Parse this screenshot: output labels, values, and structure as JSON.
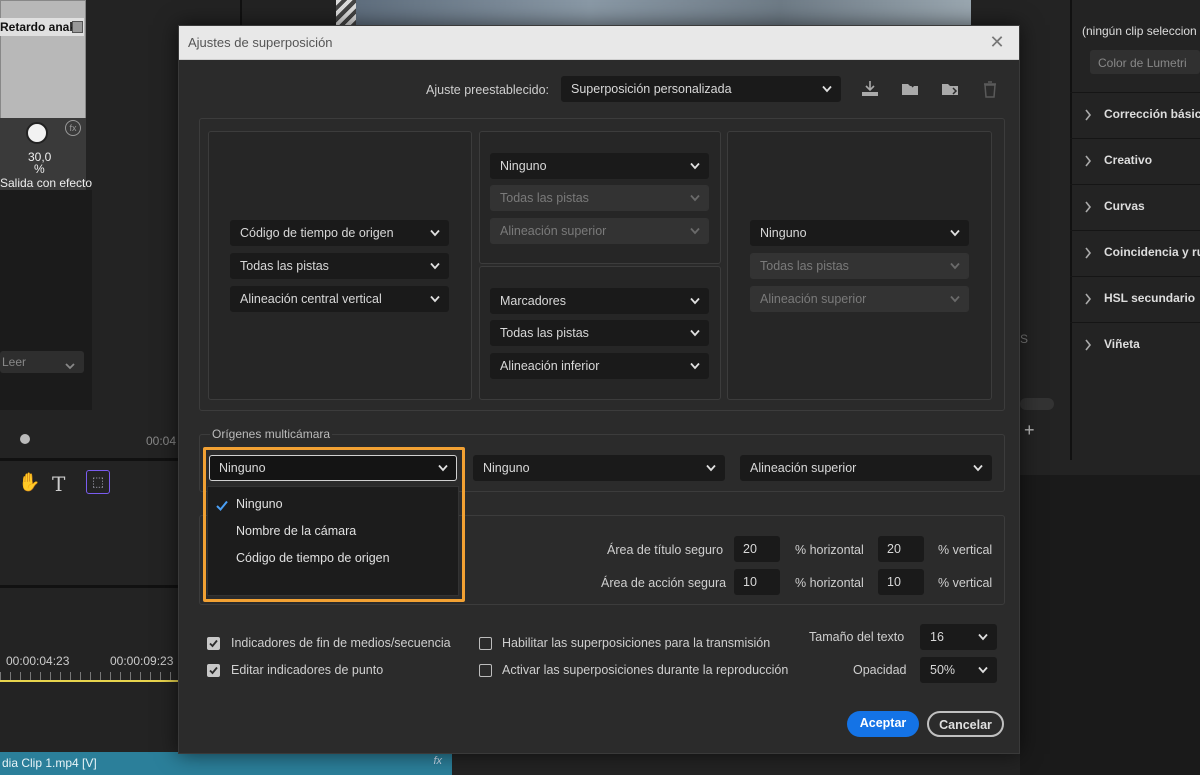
{
  "background": {
    "effect_title": "Retardo anak",
    "effect_value": "30,0",
    "effect_unit": "%",
    "effect_output": "Salida con efecto",
    "read_select": "Leer",
    "timecodes": [
      "00:04",
      "00:00:04:23",
      "00:00:09:23"
    ],
    "clip_name": "dia Clip 1.mp4 [V]",
    "lumetri_no_clip": "(ningún clip seleccion",
    "lumetri_tab": "Color de Lumetri",
    "lumetri_sections": [
      "Corrección básica",
      "Creativo",
      "Curvas",
      "Coincidencia y ru",
      "HSL secundario",
      "Viñeta"
    ],
    "side_letter": "S"
  },
  "dialog": {
    "title": "Ajustes de superposición",
    "preset_label": "Ajuste preestablecido:",
    "preset_value": "Superposición personalizada",
    "left_group": [
      "Código de tiempo de origen",
      "Todas las pistas",
      "Alineación central vertical"
    ],
    "top_center_group": [
      "Ninguno",
      "Todas las pistas",
      "Alineación superior"
    ],
    "bottom_center_group": [
      "Marcadores",
      "Todas las pistas",
      "Alineación inferior"
    ],
    "right_group": [
      "Ninguno",
      "Todas las pistas",
      "Alineación superior"
    ],
    "multicam": {
      "label": "Orígenes multicámara",
      "source_value": "Ninguno",
      "second_value": "Ninguno",
      "alignment_value": "Alineación superior",
      "options": [
        "Ninguno",
        "Nombre de la cámara",
        "Código de tiempo de origen"
      ],
      "checked": "Ninguno"
    },
    "safe": {
      "title_label": "Área de título seguro",
      "title_h": "20",
      "title_v": "20",
      "action_label": "Área de acción segura",
      "action_h": "10",
      "action_v": "10",
      "horizontal": "% horizontal",
      "vertical": "% vertical"
    },
    "checks": [
      {
        "label": "Indicadores de fin de medios/secuencia",
        "checked": true
      },
      {
        "label": "Editar indicadores de punto",
        "checked": true
      },
      {
        "label": "Habilitar las superposiciones para la transmisión",
        "checked": false
      },
      {
        "label": "Activar las superposiciones durante la reproducción",
        "checked": false
      }
    ],
    "text_size_label": "Tamaño del texto",
    "text_size_value": "16",
    "opacity_label": "Opacidad",
    "opacity_value": "50%",
    "accept": "Aceptar",
    "cancel": "Cancelar"
  },
  "colors": {
    "highlight": "#f2a133",
    "accept": "#1473e6",
    "timeline_marker": "#e8d44d"
  }
}
